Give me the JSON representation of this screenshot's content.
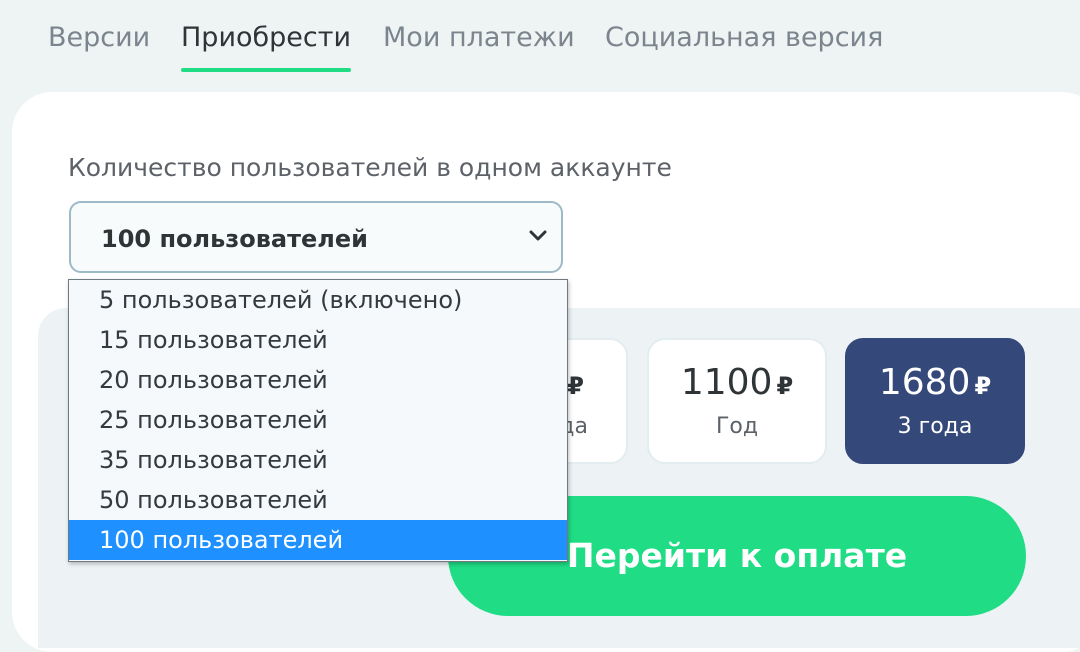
{
  "tabs": [
    {
      "label": "Версии",
      "active": false
    },
    {
      "label": "Приобрести",
      "active": true
    },
    {
      "label": "Мои платежи",
      "active": false
    },
    {
      "label": "Социальная версия",
      "active": false
    }
  ],
  "users_field": {
    "label": "Количество пользователей в одном аккаунте",
    "selected": "100 пользователей",
    "options": [
      "5 пользователей (включено)",
      "15 пользователей",
      "20 пользователей",
      "25 пользователей",
      "35 пользователей",
      "50 пользователей",
      "100 пользователей"
    ],
    "highlighted_option": "100 пользователей"
  },
  "prices": [
    {
      "amount": "",
      "currency": "₽",
      "period": "да",
      "selected": false
    },
    {
      "amount": "1100",
      "currency": "₽",
      "period": "Год",
      "selected": false
    },
    {
      "amount": "1680",
      "currency": "₽",
      "period": "3 года",
      "selected": true
    }
  ],
  "pay_button": {
    "label": "Перейти к оплате"
  },
  "colors": {
    "accent_green": "#1fdc85",
    "selected_card": "#34487a",
    "highlight_blue": "#1e90ff"
  }
}
